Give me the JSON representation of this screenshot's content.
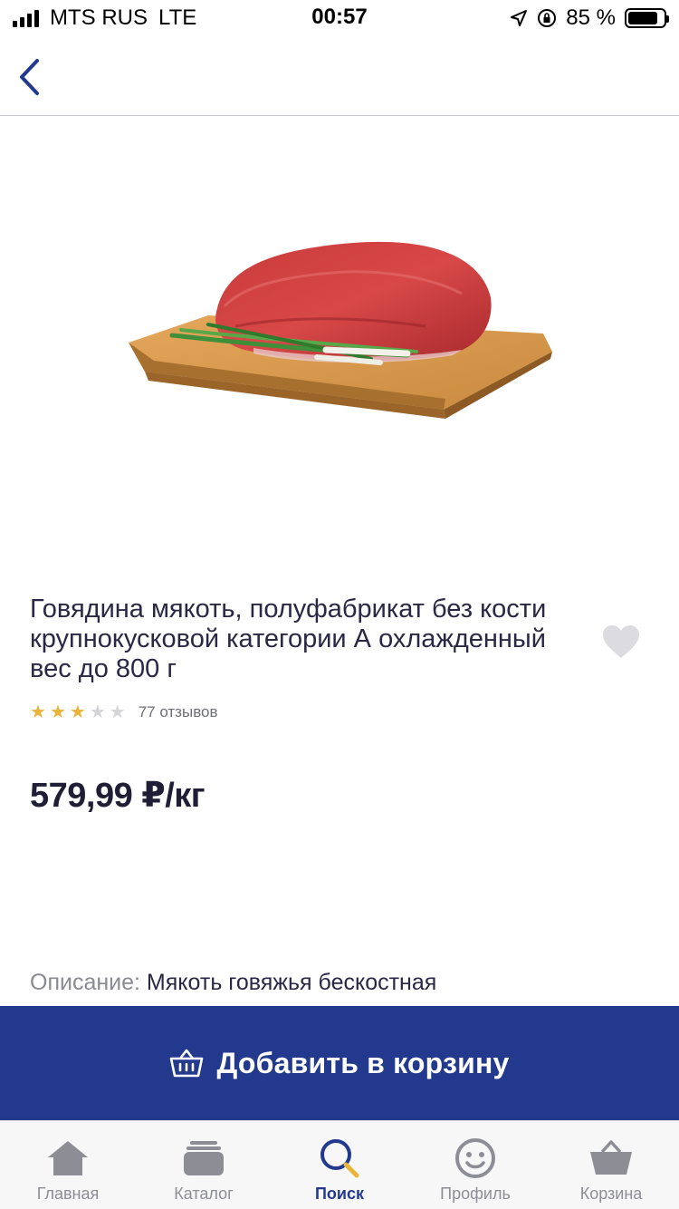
{
  "status_bar": {
    "carrier": "MTS RUS",
    "network": "LTE",
    "time": "00:57",
    "battery": "85 %",
    "battery_level": 0.85
  },
  "product": {
    "title": "Говядина мякоть, полуфабрикат без кости  крупнокусковой категории А охлажденный вес до 800 г",
    "rating": 3,
    "rating_max": 5,
    "reviews": "77 отзывов",
    "price": "579,99 ₽/кг",
    "description_label": "Описание:",
    "description_text": " Мякоть говяжья бескостная"
  },
  "add_to_cart": {
    "label": "Добавить в корзину"
  },
  "tab_bar": {
    "items": [
      {
        "label": "Главная",
        "icon": "home-icon"
      },
      {
        "label": "Каталог",
        "icon": "catalog-icon"
      },
      {
        "label": "Поиск",
        "icon": "search-icon",
        "active": true
      },
      {
        "label": "Профиль",
        "icon": "profile-icon"
      },
      {
        "label": "Корзина",
        "icon": "basket-icon"
      }
    ]
  },
  "colors": {
    "accent": "#22398d",
    "star_on": "#e8b53a",
    "star_off": "#d3d3d8",
    "tab_inactive": "#8d8d96"
  }
}
